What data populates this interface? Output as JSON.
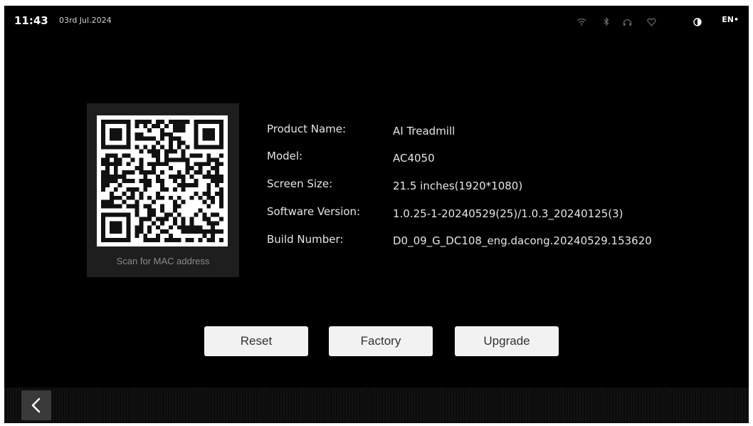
{
  "status_bar": {
    "time": "11:43",
    "date": "03rd Jul.2024",
    "language": "EN•",
    "icons": [
      "wifi-icon",
      "bluetooth-icon",
      "headphones-icon",
      "heart-rate-icon",
      "contrast-icon"
    ]
  },
  "qr": {
    "caption": "Scan for MAC address"
  },
  "info": [
    {
      "label": "Product Name:",
      "value": "AI Treadmill"
    },
    {
      "label": "Model:",
      "value": "AC4050"
    },
    {
      "label": "Screen Size:",
      "value": "21.5 inches(1920*1080)"
    },
    {
      "label": "Software Version:",
      "value": "1.0.25-1-20240529(25)/1.0.3_20240125(3)"
    },
    {
      "label": "Build Number:",
      "value": "D0_09_G_DC108_eng.dacong.20240529.153620"
    }
  ],
  "buttons": {
    "reset": "Reset",
    "factory": "Factory",
    "upgrade": "Upgrade"
  },
  "navigation": {
    "back_icon": "chevron-left-icon"
  }
}
